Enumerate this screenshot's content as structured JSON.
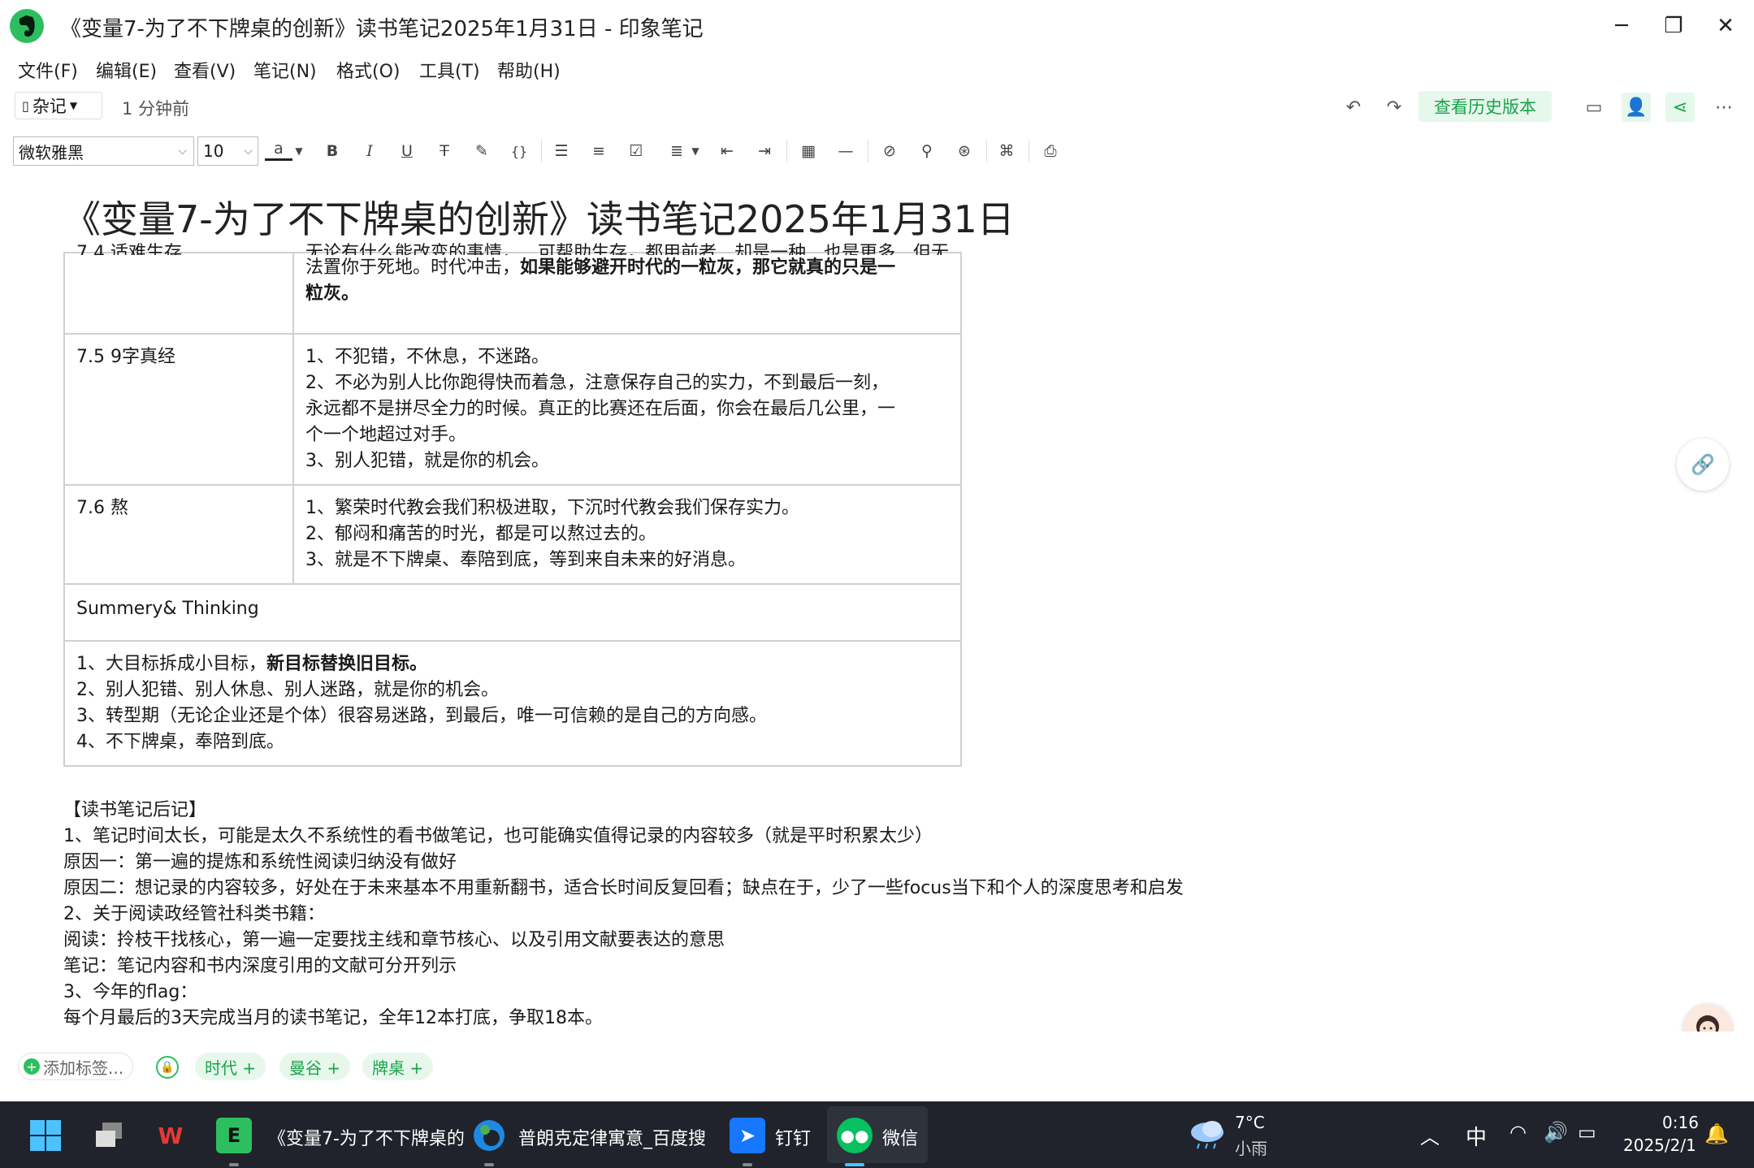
{
  "window": {
    "title": "《变量7-为了不下牌桌的创新》读书笔记2025年1月31日 - 印象笔记",
    "minimize_glyph": "─",
    "restore_glyph": "❐",
    "close_glyph": "✕"
  },
  "menu": [
    "文件(F)",
    "编辑(E)",
    "查看(V)",
    "笔记(N)",
    "格式(O)",
    "工具(T)",
    "帮助(H)"
  ],
  "note_header": {
    "notebook": "杂记",
    "saved_time": "1 分钟前",
    "history_button": "查看历史版本"
  },
  "format_toolbar": {
    "font": "微软雅黑",
    "font_size": "10",
    "text_color_glyph": "a",
    "bold": "B",
    "italic": "I",
    "underline": "U",
    "strike": "T",
    "code": "{}",
    "divider": "—"
  },
  "note": {
    "title": "《变量7-为了不下牌桌的创新》读书笔记2025年1月31日",
    "table": {
      "row0": {
        "col1": "7.4 适难生存",
        "col2_line1": "无论有什么能改变的事情，…可帮助生存，都用前者…却是一种…也是更多…但无",
        "col2_line2_normal": "法置你于死地。时代冲击，",
        "col2_line2_bold": "如果能够避开时代的一粒灰，那它就真的只是一",
        "col2_line3_bold": "粒灰。"
      },
      "row1": {
        "col1": "7.5 9字真经",
        "lines": [
          "1、不犯错，不休息，不迷路。",
          "2、不必为别人比你跑得快而着急，注意保存自己的实力，不到最后一刻，",
          "永远都不是拼尽全力的时候。真正的比赛还在后面，你会在最后几公里，一",
          "个一个地超过对手。",
          "3、别人犯错，就是你的机会。"
        ]
      },
      "row2": {
        "col1": "7.6 熬",
        "lines": [
          "1、繁荣时代教会我们积极进取，下沉时代教会我们保存实力。",
          "2、郁闷和痛苦的时光，都是可以熬过去的。",
          "3、就是不下牌桌、奉陪到底，等到来自未来的好消息。"
        ]
      },
      "summary_header": "Summery& Thinking",
      "summary": {
        "line1_normal": "1、大目标拆成小目标，",
        "line1_bold": "新目标替换旧目标。",
        "line2": "2、别人犯错、别人休息、别人迷路，就是你的机会。",
        "line3": "3、转型期（无论企业还是个体）很容易迷路，到最后，唯一可信赖的是自己的方向感。",
        "line4": "4、不下牌桌，奉陪到底。"
      }
    },
    "after_notes": [
      "【读书笔记后记】",
      "1、笔记时间太长，可能是太久不系统性的看书做笔记，也可能确实值得记录的内容较多（就是平时积累太少）",
      "原因一：第一遍的提炼和系统性阅读归纳没有做好",
      "原因二：想记录的内容较多，好处在于未来基本不用重新翻书，适合长时间反复回看；缺点在于，少了一些focus当下和个人的深度思考和启发",
      "2、关于阅读政经管社科类书籍：",
      "阅读：拎枝干找核心，第一遍一定要找主线和章节核心、以及引用文献要表达的意思",
      "笔记：笔记内容和书内深度引用的文献可分开列示",
      "3、今年的flag：",
      "每个月最后的3天完成当月的读书笔记，全年12本打底，争取18本。"
    ]
  },
  "tags": {
    "add_label": "添加标签...",
    "items": [
      "时代 +",
      "曼谷 +",
      "牌桌 +"
    ]
  },
  "taskbar": {
    "apps": [
      {
        "label": "《变量7-为了不下牌桌的",
        "color": "#2dbe60"
      },
      {
        "label": "普朗克定律寓意_百度搜",
        "color": "#1e88e5"
      },
      {
        "label": "钉钉",
        "color": "#1677ff"
      },
      {
        "label": "微信",
        "color": "#07c160"
      }
    ],
    "weather_temp": "7°C",
    "weather_desc": "小雨",
    "ime": "中",
    "time": "0:16",
    "date": "2025/2/1"
  },
  "colors": {
    "brand_green": "#2dbe60",
    "accent_green_text": "#1aa34a",
    "taskbar_bg": "#20232b"
  }
}
